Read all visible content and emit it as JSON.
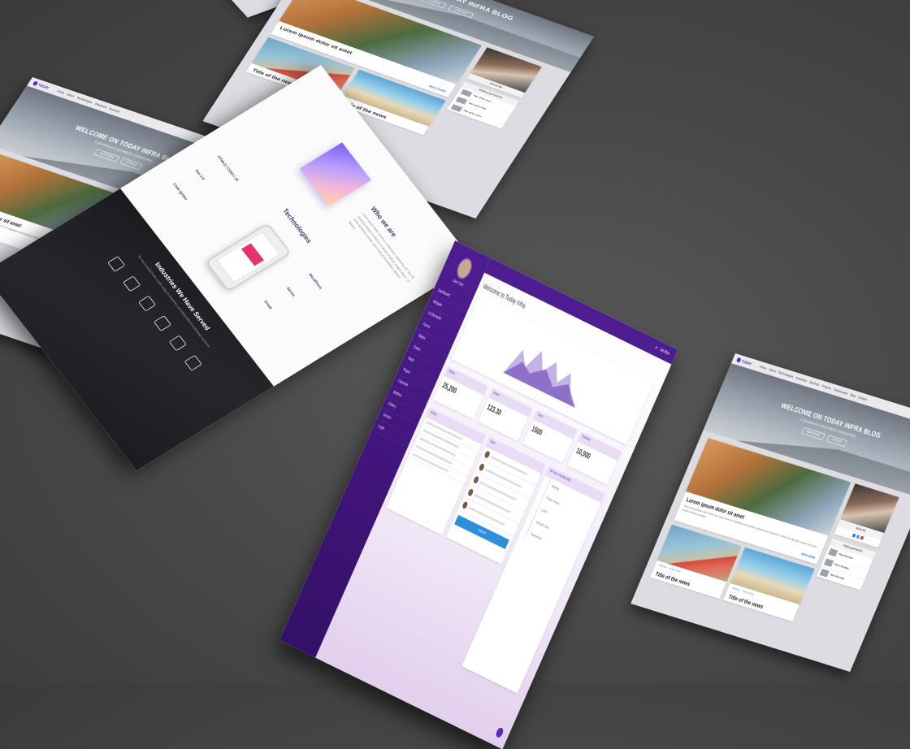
{
  "blog": {
    "logo_text": "TODAY",
    "nav_items": [
      "Home",
      "About",
      "Technologies",
      "Industries",
      "Services",
      "Projects",
      "Testimonials",
      "Blog",
      "Contact"
    ],
    "hero_title": "WELCOME ON TODAY INFRA BLOG",
    "hero_subtitle": "IT BUSINESS & BUSINESS CONSULTING",
    "hero_btn_1": "READ MORE",
    "hero_btn_2": "CONTACT",
    "featured_title": "Lorem ipsum dolor sit amet",
    "featured_text": "Sed ut perspiciatis unde omnis iste natus error sit voluptatem accusantium doloremque laudantium, totam rem aperiam, eaque ipsa quae ab illo inventore veritatis.",
    "read_more": "READ MORE",
    "post_1_tag": "TRAVEL · JUNE 2018",
    "post_1_title": "Title of the news",
    "post_2_tag": "TRAVEL · JUNE 2018",
    "post_2_title": "Title of the news",
    "sidebar_about": "About Me",
    "sidebar_popular": "POPULAR POSTS",
    "popular_items": [
      "Title of the news",
      "Title of the news",
      "Title of the news"
    ]
  },
  "landing": {
    "who_title": "Who we are",
    "who_text": "Lorem ipsum dolor sit amet, consectetur adipiscing elit. Sed do eiusmod tempor incididunt ut labore et dolore magna aliqua. Ut enim ad minim veniam, quis nostrud exercitation ullamco laboris.",
    "tech_title": "Technologies",
    "tech_items": [
      "HTML5 / CSS3 / JS",
      "Vue 2.5",
      "Code Igniter",
      "WordPress",
      "Server",
      "Email"
    ],
    "industries_title": "Industries We Have Served",
    "industries_text": "We have worked with a wide range of industries, providing tailored technology solutions."
  },
  "dashboard": {
    "user_name": "Jane Doe",
    "nav_items": [
      "Dashboard",
      "Widgets",
      "UI Elements",
      "Forms",
      "Tables",
      "Charts",
      "Maps",
      "Pages",
      "Calendar",
      "Mailbox",
      "Gallery",
      "Invoice",
      "Login"
    ],
    "topbar_user": "Joe Blue",
    "welcome": "Welcome to Today Infra",
    "stats": [
      {
        "label": "Visitors",
        "value": "25,200"
      },
      {
        "label": "Orders",
        "value": "123.30"
      },
      {
        "label": "Users",
        "value": "1500"
      },
      {
        "label": "Revenue",
        "value": "10,000"
      }
    ],
    "activity_title": "Activity",
    "team_title": "Team",
    "team_button": "View all",
    "timeline_title": "We have meeting today",
    "timeline_items": [
      "Meeting",
      "Project review",
      "Lunch",
      "Call with client",
      "Deployment"
    ]
  },
  "colors": {
    "accent": "#5b2bb5",
    "sidebar": "#4f1d92",
    "background": "#4a4a4a"
  }
}
